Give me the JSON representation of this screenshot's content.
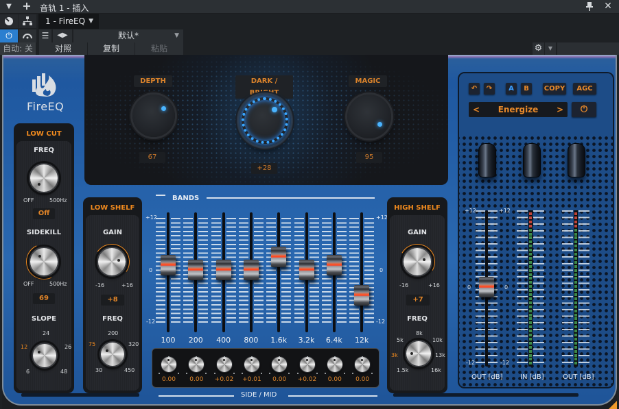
{
  "host": {
    "window_title": "音轨 1 - 插入",
    "plugin_slot": "1 - FireEQ",
    "preset": "默认*",
    "auto_label": "自动: 关",
    "compare_label": "对照",
    "copy_label": "复制",
    "paste_label": "粘贴",
    "icons": {
      "collapse": "▼",
      "add": "+",
      "pin": "📌",
      "close": "✕",
      "power": "⏻",
      "routing": "⧉",
      "list": "☰",
      "prev": "◀",
      "next": "▶",
      "dropdown": "▼",
      "gear": "⚙"
    }
  },
  "plugin": {
    "name": "FireEQ",
    "accent_color": "#f08a1e",
    "glow_color": "#3aa8ff",
    "top": {
      "depth": {
        "label": "DEPTH",
        "value": "67"
      },
      "dark_bright": {
        "label": "DARK / BRIGHT",
        "value": "+28"
      },
      "magic": {
        "label": "MAGIC",
        "value": "95"
      }
    },
    "low_cut": {
      "title": "LOW CUT",
      "freq_label": "FREQ",
      "freq_min": "OFF",
      "freq_max": "500Hz",
      "freq_value": "Off",
      "sidekill_label": "SIDEKILL",
      "sidekill_min": "OFF",
      "sidekill_max": "500Hz",
      "sidekill_value": "69",
      "slope_label": "SLOPE",
      "slope_options": [
        "6",
        "12",
        "24",
        "26",
        "48"
      ],
      "slope_selected": "12"
    },
    "low_shelf": {
      "title": "LOW SHELF",
      "gain_label": "GAIN",
      "gain_min": "-16",
      "gain_max": "+16",
      "gain_value": "+8",
      "freq_label": "FREQ",
      "freq_options": [
        "30",
        "75",
        "200",
        "320",
        "450"
      ],
      "freq_selected": "75"
    },
    "high_shelf": {
      "title": "HIGH SHELF",
      "gain_label": "GAIN",
      "gain_min": "-16",
      "gain_max": "+16",
      "gain_value": "+7",
      "freq_label": "FREQ",
      "freq_options": [
        "1.5k",
        "3k",
        "5k",
        "8k",
        "10k",
        "13k",
        "16k"
      ],
      "freq_selected": "3k"
    },
    "bands": {
      "title": "BANDS",
      "scale": {
        "max": "+12",
        "mid": "0",
        "min": "-12"
      },
      "range_db": [
        -12,
        12
      ],
      "items": [
        {
          "freq": "100",
          "gain_db": 1,
          "side_mid": "0.00"
        },
        {
          "freq": "200",
          "gain_db": 0,
          "side_mid": "0.00"
        },
        {
          "freq": "400",
          "gain_db": 0,
          "side_mid": "+0.02"
        },
        {
          "freq": "800",
          "gain_db": 0,
          "side_mid": "+0.01"
        },
        {
          "freq": "1.6k",
          "gain_db": 3,
          "side_mid": "0.00"
        },
        {
          "freq": "3.2k",
          "gain_db": 0,
          "side_mid": "+0.02"
        },
        {
          "freq": "6.4k",
          "gain_db": 1,
          "side_mid": "0.00"
        },
        {
          "freq": "12k",
          "gain_db": -6,
          "side_mid": "0.00"
        }
      ],
      "side_mid_title": "SIDE / MID"
    },
    "right": {
      "undo": "↶",
      "redo": "↷",
      "a_label": "A",
      "b_label": "B",
      "copy_label": "COPY",
      "agc_label": "AGC",
      "preset_name": "Energize",
      "prev": "<",
      "next": ">",
      "power": "⏻",
      "out_fader_db": 0,
      "out_scale": {
        "max": "+12",
        "mid": "0",
        "min": "-12"
      },
      "out_label": "OUT [dB]",
      "in_meter_label": "IN [dB]",
      "out_meter_label": "OUT [dB]"
    }
  }
}
